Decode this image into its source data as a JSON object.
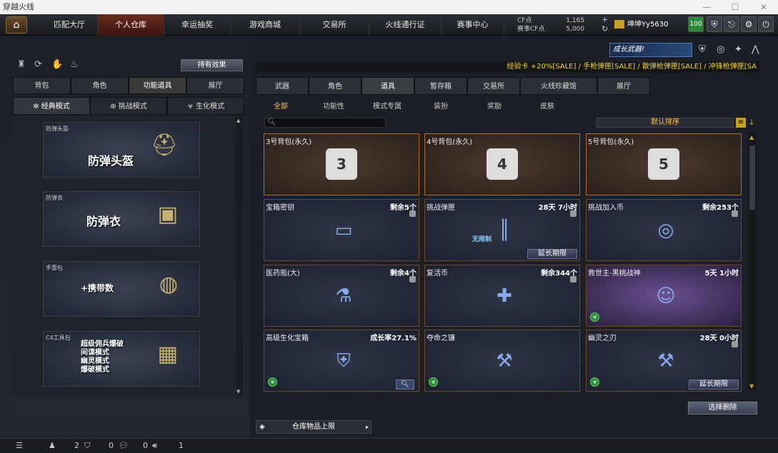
{
  "window": {
    "title": "穿越火线"
  },
  "nav": {
    "tabs": [
      "匹配大厅",
      "个人仓库",
      "幸运抽奖",
      "游戏商城",
      "交易所",
      "火线通行证",
      "赛事中心"
    ],
    "active": 1,
    "cf_label": "CF点",
    "cf_value": "1,165",
    "sscf_label": "赛事CF点",
    "sscf_value": "5,000",
    "username": "坤坤Yy5630",
    "level": "100"
  },
  "left": {
    "hold_effect": "持有效果",
    "tabs": [
      "背包",
      "角色",
      "功能道具",
      "展厅"
    ],
    "active_tab": 2,
    "modes": [
      "经典模式",
      "挑战模式",
      "生化模式"
    ],
    "active_mode": 0,
    "items": [
      {
        "label": "防弹头盔",
        "title": "防弹头盔"
      },
      {
        "label": "防弹衣",
        "title": "防弹衣"
      },
      {
        "label": "手雷包",
        "title": "+携带数"
      },
      {
        "label": "C4工具包",
        "title": "超级佣兵爆破\n间谍模式\n幽灵模式\n爆破模式"
      }
    ]
  },
  "right": {
    "promo": "经验卡 +20%[SALE] / 手枪弹匣[SALE] / 散弹枪弹匣[SALE] / 冲锋枪弹匣[SA",
    "banner": "成长武器!",
    "tabs": [
      "武器",
      "角色",
      "道具",
      "暂存箱",
      "交易所",
      "火线珍藏馆",
      "展厅"
    ],
    "active_tab": 2,
    "filters": [
      "全部",
      "功能性",
      "模式专属",
      "装扮",
      "奖励",
      "皮肤"
    ],
    "active_filter": 0,
    "search_placeholder": "",
    "sort": "默认排序",
    "items": [
      {
        "name": "3号背包(永久)",
        "right": "",
        "icon": "bag-3-icon",
        "glyph": "3",
        "warm": true
      },
      {
        "name": "4号背包(永久)",
        "right": "",
        "icon": "bag-4-icon",
        "glyph": "4",
        "warm": true
      },
      {
        "name": "5号背包(永久)",
        "right": "",
        "icon": "bag-5-icon",
        "glyph": "5",
        "warm": true
      },
      {
        "name": "宝箱密钥",
        "right": "剩余5个",
        "icon": "key-card-icon",
        "glyph": "▭"
      },
      {
        "name": "挑战弹匣",
        "right": "28天 7小时",
        "icon": "ammo-icon",
        "glyph": "║",
        "badge": "无限制",
        "extend": "延长期限"
      },
      {
        "name": "挑战加入币",
        "right": "剩余253个",
        "icon": "coin-icon",
        "glyph": "◎"
      },
      {
        "name": "医药瓶(大)",
        "right": "剩余4个",
        "icon": "medicine-icon",
        "glyph": "⚗"
      },
      {
        "name": "复活币",
        "right": "剩余344个",
        "icon": "revive-icon",
        "glyph": "✚"
      },
      {
        "name": "救世主-黑桃战神",
        "right": "5天 1小时",
        "icon": "character-icon",
        "glyph": "☺",
        "green": true
      },
      {
        "name": "高级生化宝箱",
        "right": "成长率27.1%",
        "icon": "shield-box-icon",
        "glyph": "⛨",
        "green": true,
        "search": true
      },
      {
        "name": "夺命之镰",
        "right": "",
        "icon": "scythe-icon",
        "glyph": "⚒",
        "green": true
      },
      {
        "name": "幽灵之刃",
        "right": "28天 0小时",
        "icon": "scythe-icon",
        "glyph": "⚒",
        "green": true,
        "extend": "延长期限"
      }
    ],
    "delete_button": "选择删除",
    "limit_label": "仓库物品上限"
  },
  "bottom": {
    "a": "2",
    "b": "0",
    "c": "0",
    "d": "1"
  }
}
